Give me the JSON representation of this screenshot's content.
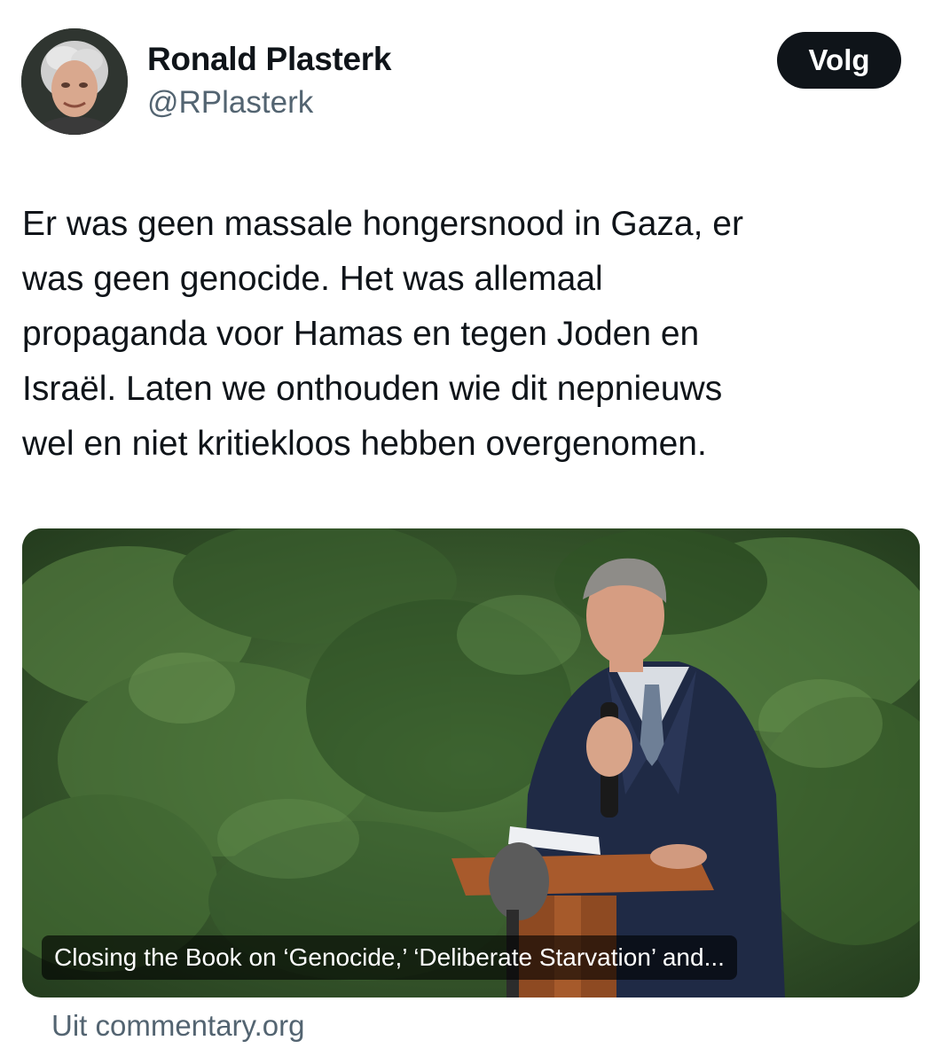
{
  "author": {
    "display_name": "Ronald Plasterk",
    "handle": "@RPlasterk",
    "avatar_icon": "profile-photo"
  },
  "follow_button": {
    "label": "Volg"
  },
  "tweet": {
    "text_lines": [
      "Er was geen massale hongersnood in Gaza, er",
      "was geen genocide. Het was allemaal",
      "propaganda voor Hamas en tegen Joden en",
      "Israël. Laten we onthouden wie dit nepnieuws",
      "wel en niet kritiekloos hebben overgenomen."
    ]
  },
  "card": {
    "caption": "Closing the Book on ‘Genocide,’ ‘Deliberate Starvation’ and...",
    "source": "Uit commentary.org"
  },
  "colors": {
    "text_primary": "#0f1419",
    "text_secondary": "#536471",
    "button_bg": "#0f1419",
    "button_text": "#ffffff"
  }
}
